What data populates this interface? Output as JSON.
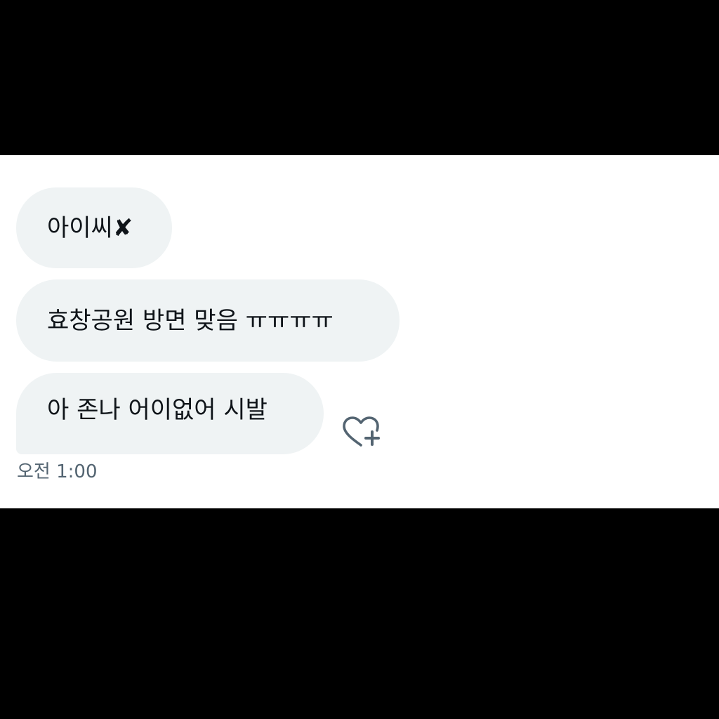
{
  "messages": [
    {
      "text": "아이씨✘"
    },
    {
      "text": "효창공원 방면 맞음 ㅠㅠㅠㅠ"
    },
    {
      "text": "아 존나 어이없어 시발"
    }
  ],
  "timestamp": "오전 1:00",
  "icons": {
    "reaction": "heart-plus-icon"
  },
  "colors": {
    "bubble_background": "#eff3f4",
    "message_text": "#0f1419",
    "meta_text": "#536471",
    "letterbox": "#000000",
    "panel_background": "#ffffff"
  }
}
